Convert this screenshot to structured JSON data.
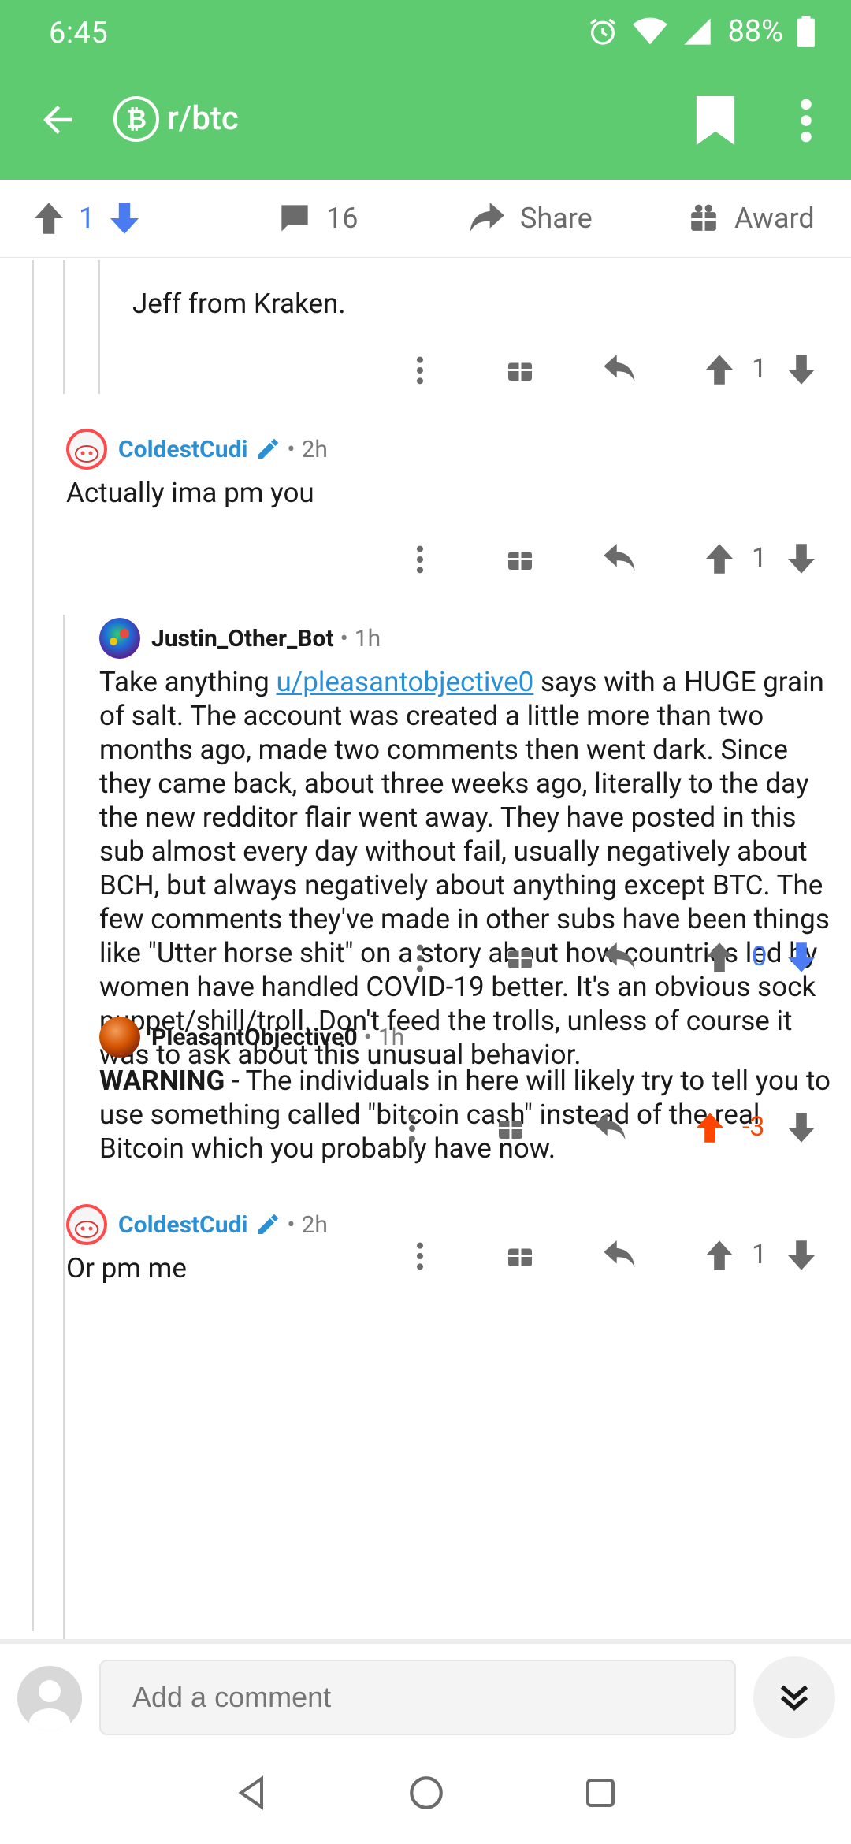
{
  "status_bar": {
    "time": "6:45",
    "battery": "88%"
  },
  "app_bar": {
    "subreddit": "r/btc",
    "sub_icon": "bitcoin-icon"
  },
  "post_bar": {
    "score": "1",
    "comments": "16",
    "share": "Share",
    "award": "Award"
  },
  "comments": [
    {
      "id": "c0",
      "body": "Jeff from Kraken.",
      "score": "1"
    },
    {
      "id": "c1",
      "author": "ColdestCudi",
      "age": "2h",
      "body": "Actually ima pm you",
      "score": "1"
    },
    {
      "id": "c2",
      "author": "Justin_Other_Bot",
      "age": "1h",
      "body_prefix": "Take anything ",
      "body_link": "u/pleasantobjective0",
      "body_suffix": " says with a HUGE grain of salt. The account was created a little more than two months ago, made two comments then went dark. Since they came back, about three weeks ago, literally to the day the new redditor flair went away. They have posted in this sub almost every day without fail, usually negatively about BCH, but always negatively about anything except BTC.  The few comments they've made in other subs have been things like \"Utter horse shit\" on a story about how countries led by women have handled COVID-19 better.  It's an obvious sock puppet/shill/troll. Don't feed the trolls, unless of course it was to ask about this unusual behavior.",
      "score": "0"
    },
    {
      "id": "c3",
      "author": "PleasantObjective0",
      "age": "1h",
      "body_bold": "WARNING",
      "body_rest": " - The individuals in here will likely try to tell you to use something called \"bitcoin cash\" instead of the real Bitcoin which you probably have now.",
      "score": "-3"
    },
    {
      "id": "c4",
      "author": "ColdestCudi",
      "age": "2h",
      "body": "Or pm me",
      "score": "1"
    }
  ],
  "comment_input": {
    "placeholder": "Add a comment"
  },
  "colors": {
    "green": "#5fcb71",
    "blue": "#2b8fd6",
    "upvote_orange": "#ff4500",
    "downvote_blue": "#4a7bf2"
  }
}
